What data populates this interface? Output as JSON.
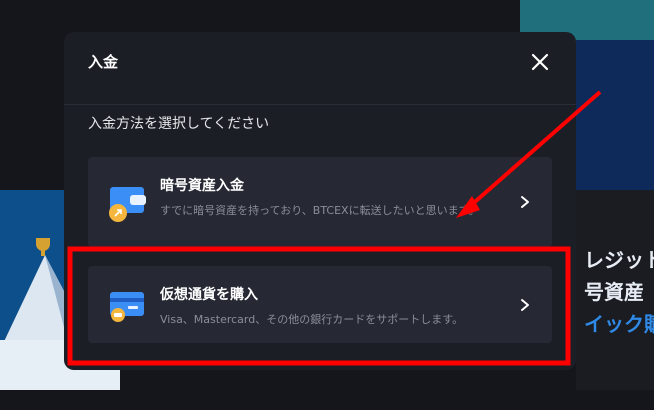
{
  "background": {
    "text_line_1": "レジット",
    "text_line_2": "号資産",
    "text_line_3": "イック購"
  },
  "modal": {
    "title": "入金",
    "subtitle": "入金方法を選択してください",
    "options": [
      {
        "title": "暗号資産入金",
        "description": "すでに暗号資産を持っており、BTCEXに転送したいと思います。",
        "icon": "wallet-icon"
      },
      {
        "title": "仮想通貨を購入",
        "description": "Visa、Mastercard、その他の銀行カードをサポートします。",
        "icon": "credit-card-icon"
      }
    ]
  },
  "annotation": {
    "color": "#ff0000"
  }
}
